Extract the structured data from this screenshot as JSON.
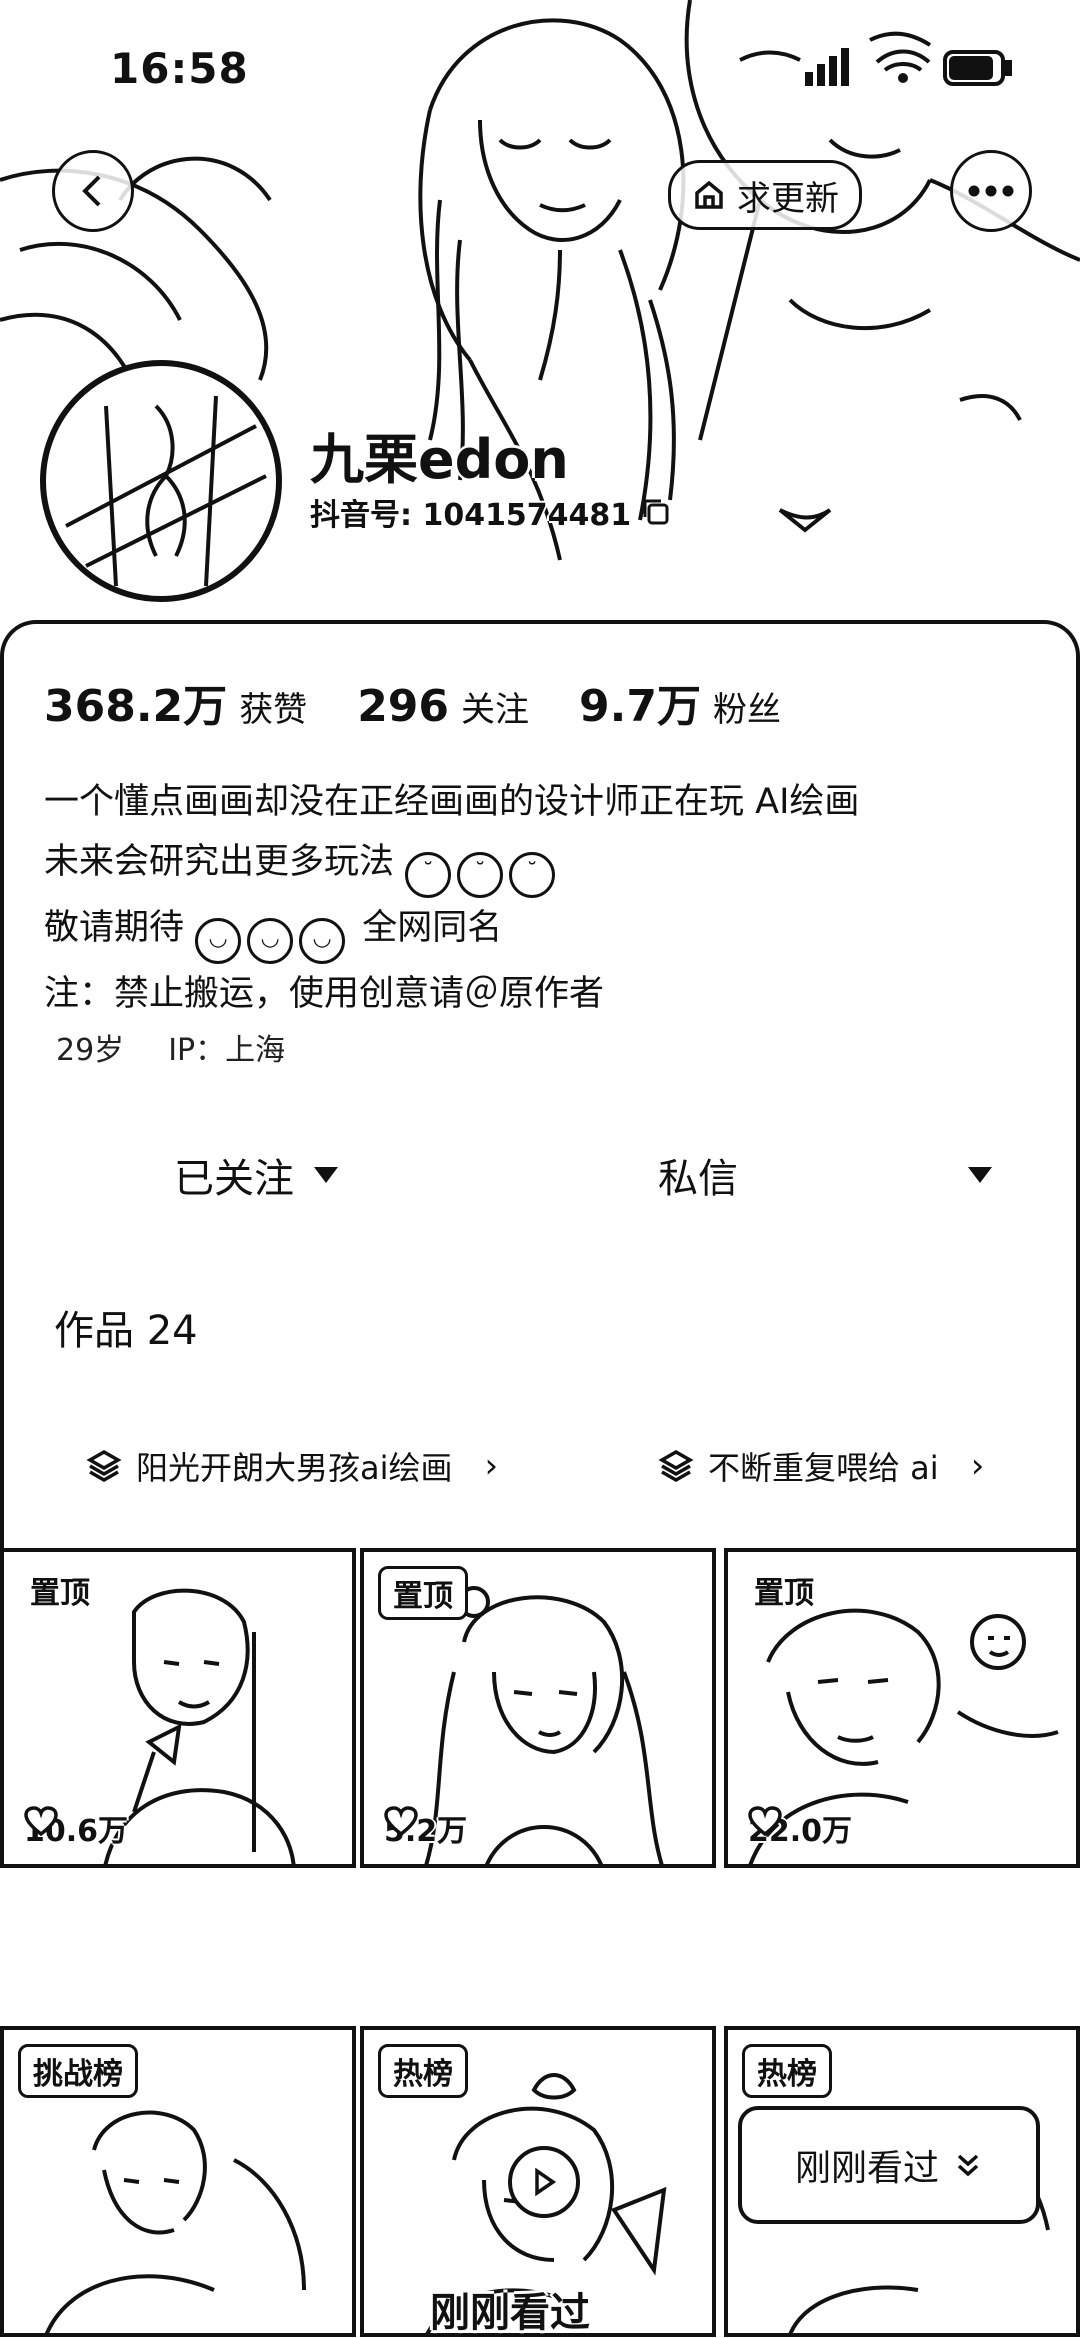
{
  "status_bar": {
    "time": "16:58"
  },
  "header": {
    "update_button_label": "求更新",
    "nickname": "九栗edon",
    "douyin_id": "抖音号: 1041574481"
  },
  "stats": [
    {
      "value": "368.2万",
      "label": "获赞"
    },
    {
      "value": "296",
      "label": "关注"
    },
    {
      "value": "9.7万",
      "label": "粉丝"
    }
  ],
  "bio": {
    "line1": "一个懂点画画却没在正经画画的设计师正在玩 AI绘画",
    "line2": "未来会研究出更多玩法",
    "line3_a": "敬请期待",
    "line3_b": "全网同名",
    "line4": "注：禁止搬运，使用创意请＠原作者"
  },
  "meta": {
    "age": "29岁",
    "ip": "IP：上海"
  },
  "actions": {
    "follow": "已关注",
    "message": "私信"
  },
  "works": {
    "label": "作品 24"
  },
  "collections": [
    {
      "title": "阳光开朗大男孩ai绘画"
    },
    {
      "title": "不断重复喂给 ai"
    }
  ],
  "grid": [
    {
      "tag": "置顶",
      "likes": "10.6万"
    },
    {
      "tag": "置顶",
      "likes": "5.2万"
    },
    {
      "tag": "置顶",
      "likes": "22.0万"
    },
    {
      "tag": "挑战榜",
      "likes": ""
    },
    {
      "tag": "热榜",
      "likes": ""
    },
    {
      "tag": "热榜",
      "likes": ""
    }
  ],
  "recent": {
    "pill_label": "刚刚看过",
    "overlay_label": "刚刚看过"
  },
  "icons": {
    "back": "back-arrow-icon",
    "more": "more-dots-icon",
    "update": "update-icon",
    "heart": "heart-icon",
    "layers": "layers-icon",
    "chevron": "chevron-right-icon",
    "copy": "copy-icon",
    "play": "play-icon",
    "double_chevron": "double-chevron-down-icon"
  }
}
